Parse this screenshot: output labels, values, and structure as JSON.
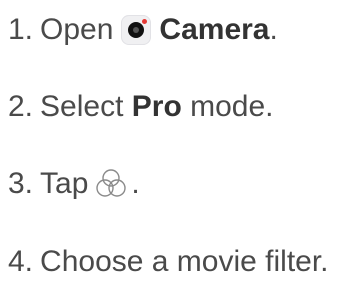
{
  "steps": [
    {
      "number": "1.",
      "prefix": "Open",
      "bold": "Camera",
      "suffix": ".",
      "icon": "camera-app-icon"
    },
    {
      "number": "2.",
      "prefix": "Select",
      "bold": "Pro",
      "suffix": "mode."
    },
    {
      "number": "3.",
      "prefix": "Tap",
      "suffix": ".",
      "icon": "filter-icon"
    },
    {
      "number": "4.",
      "text": "Choose a movie filter."
    }
  ],
  "colors": {
    "text": "#4a4a4a",
    "bold_text": "#333333",
    "camera_dot": "#e53935"
  }
}
